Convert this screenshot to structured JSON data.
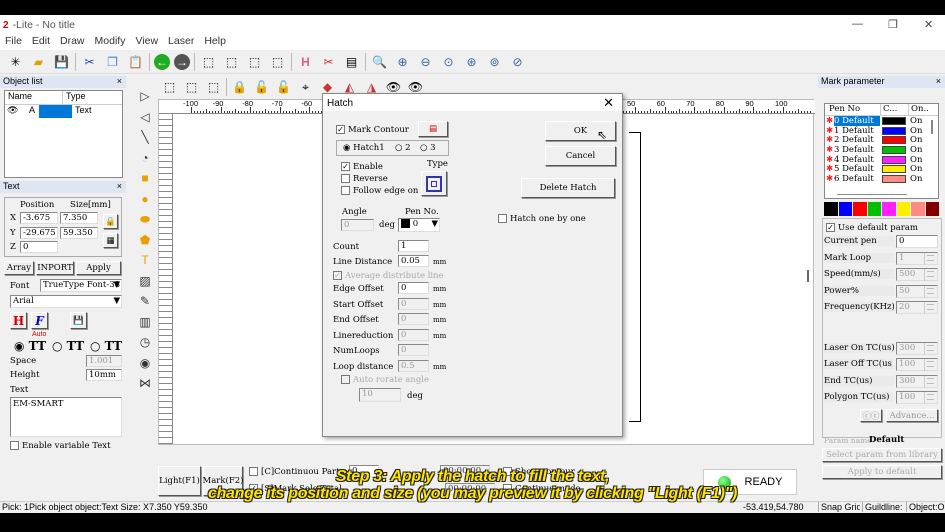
{
  "window": {
    "title": "-Lite  - No title"
  },
  "menu": [
    "File",
    "Edit",
    "Draw",
    "Modify",
    "View",
    "Laser",
    "Help"
  ],
  "object_list": {
    "title": "Object list",
    "columns": [
      "Name",
      "Type"
    ],
    "rows": [
      {
        "name": "A",
        "type": "Text"
      }
    ]
  },
  "text_panel": {
    "title": "Text",
    "position_label": "Position",
    "size_label": "Size[mm]",
    "x_label": "X",
    "y_label": "Y",
    "z_label": "Z",
    "x": "-3.675",
    "y": "-29.675",
    "z": "0",
    "size_x": "7.350",
    "size_y": "59.350",
    "array": "Array",
    "import": "INPORT",
    "apply": "Apply",
    "font_label": "Font",
    "font_type": "TrueType Font-38",
    "font_name": "Arial",
    "auto_label": "Auto",
    "space_label": "Space",
    "space": "1.001",
    "height_label": "Height",
    "height": "10mm",
    "text_label": "Text",
    "text": "EM-SMART",
    "enable_variable": "Enable variable Text"
  },
  "ruler": {
    "ticks": [
      -100,
      -90,
      -80,
      -70,
      -60,
      -50,
      -40,
      -30,
      -20,
      -10,
      0,
      10,
      20,
      30,
      40,
      50,
      60,
      70,
      80,
      90,
      100
    ]
  },
  "hatch": {
    "title": "Hatch",
    "mark_contour": "Mark Contour",
    "mark_contour_checked": true,
    "hatch_tabs": [
      "Hatch1",
      "2",
      "3"
    ],
    "hatch_selected": "Hatch1",
    "enable": "Enable",
    "enable_checked": true,
    "reverse": "Reverse",
    "follow_edge": "Follow edge on",
    "type_label": "Type",
    "angle_label": "Angle",
    "angle": "0",
    "deg": "deg",
    "pen_label": "Pen No.",
    "pen": "0",
    "count_label": "Count",
    "count": "1",
    "line_distance_label": "Line Distance",
    "line_distance": "0.05",
    "mm": "mm",
    "average_distribute": "Average distribute line",
    "edge_offset_label": "Edge Offset",
    "edge_offset": "0",
    "start_offset_label": "Start Offset",
    "start_offset": "0",
    "end_offset_label": "End Offset",
    "end_offset": "0",
    "linereduction_label": "Linereduction",
    "linereduction": "0",
    "numloops_label": "NumLoops",
    "numloops": "0",
    "loop_distance_label": "Loop distance",
    "loop_distance": "0.5",
    "auto_rotate": "Auto rorate angle",
    "auto_rotate_value": "10",
    "ok": "OK",
    "cancel": "Cancel",
    "delete_hatch": "Delete Hatch",
    "hatch_one_by_one": "Hatch one by one"
  },
  "mark_param": {
    "title": "Mark parameter",
    "columns": [
      "Pen No",
      "C...",
      "On.."
    ],
    "pens": [
      {
        "name": "0 Default",
        "color": "#000000",
        "on": "On"
      },
      {
        "name": "1 Default",
        "color": "#0000ff",
        "on": "On"
      },
      {
        "name": "2 Default",
        "color": "#ff0000",
        "on": "On"
      },
      {
        "name": "3 Default",
        "color": "#00c000",
        "on": "On"
      },
      {
        "name": "4 Default",
        "color": "#ff20ff",
        "on": "On"
      },
      {
        "name": "5 Default",
        "color": "#ffee00",
        "on": "On"
      },
      {
        "name": "6 Default",
        "color": "#ff8c80",
        "on": "On"
      }
    ],
    "palette": [
      "#000000",
      "#0000ff",
      "#ff0000",
      "#00c000",
      "#ff20ff",
      "#ffee00",
      "#ff8c80",
      "#800000"
    ],
    "use_default": "Use default param",
    "fields": [
      {
        "label": "Current pen",
        "value": "0"
      },
      {
        "label": "Mark Loop",
        "value": "1"
      },
      {
        "label": "Speed(mm/s)",
        "value": "500"
      },
      {
        "label": "Power%",
        "value": "50"
      },
      {
        "label": "Frequency(KHz)",
        "value": "20"
      },
      {
        "label": "Laser On TC(us)",
        "value": "300"
      },
      {
        "label": "Laser Off TC(us",
        "value": "100"
      },
      {
        "label": "End TC(us)",
        "value": "300"
      },
      {
        "label": "Polygon TC(us)",
        "value": "100"
      }
    ],
    "advance": "Advance...",
    "param_name_label": "Param name",
    "param_name": "Default",
    "select_library": "Select param from library",
    "apply_default": "Apply to default"
  },
  "bottom": {
    "light": "Light(F1)",
    "mark": "Mark(F2)",
    "continuous": "[C]Continuou Part",
    "part_value": "0",
    "mark_selected": "[S]Mark Sele Total",
    "time1": "00:00:00",
    "time2": "00:00:00",
    "show_contour": "Show contour",
    "continue_mode": "Continue mode",
    "ready": "READY"
  },
  "status": {
    "left": "Pick: 1Pick object object:Text Size: X7.350 Y59.350",
    "coords": "-53.419,54.780",
    "snap": "Snap Grid",
    "guideline": "Guildline:",
    "object": "Object:O"
  },
  "caption": {
    "line1": "Step 3: Apply the hatch to fill the text,",
    "line2": "change its position and size (you may preview it by clicking \"Light (F1)\")"
  }
}
